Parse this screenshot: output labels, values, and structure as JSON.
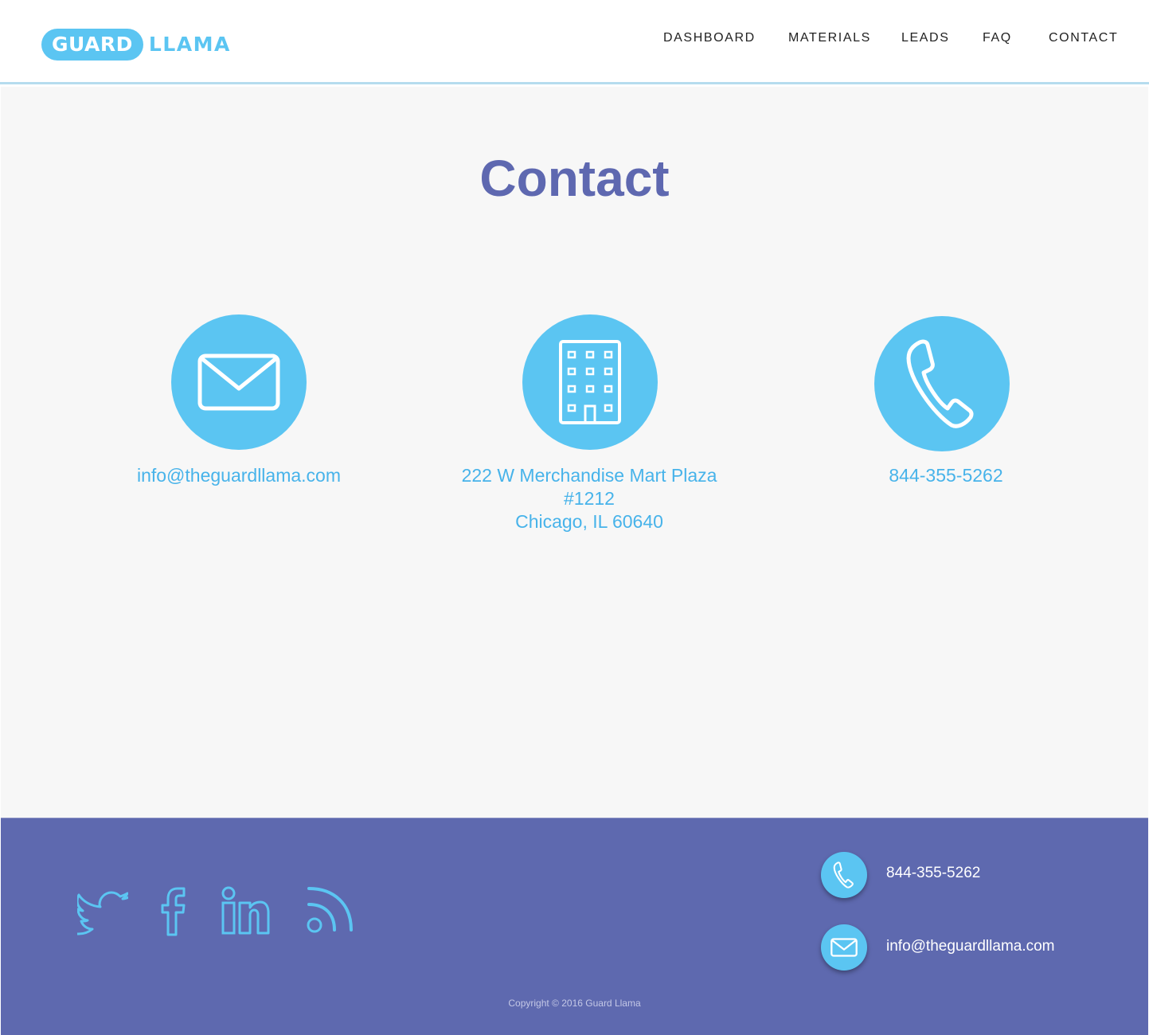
{
  "brand": {
    "logo_primary": "GUARD",
    "logo_secondary": "LLAMA",
    "accent_color": "#5bc5f2",
    "title_color": "#5e68b0",
    "footer_color": "#5e69af"
  },
  "nav": {
    "items": [
      {
        "label": "DASHBOARD"
      },
      {
        "label": "MATERIALS"
      },
      {
        "label": "LEADS"
      },
      {
        "label": "FAQ"
      },
      {
        "label": "CONTACT"
      }
    ]
  },
  "main": {
    "title": "Contact",
    "cards": [
      {
        "icon": "envelope-icon",
        "lines": [
          "info@theguardllama.com"
        ]
      },
      {
        "icon": "building-icon",
        "lines": [
          "222 W Merchandise Mart Plaza",
          "#1212",
          "Chicago, IL 60640"
        ]
      },
      {
        "icon": "phone-icon",
        "lines": [
          "844-355-5262"
        ]
      }
    ]
  },
  "footer": {
    "social": [
      {
        "icon": "twitter-icon"
      },
      {
        "icon": "facebook-icon"
      },
      {
        "icon": "linkedin-icon"
      },
      {
        "icon": "rss-icon"
      }
    ],
    "phone": "844-355-5262",
    "email": "info@theguardllama.com",
    "copyright": "Copyright © 2016 Guard Llama"
  }
}
